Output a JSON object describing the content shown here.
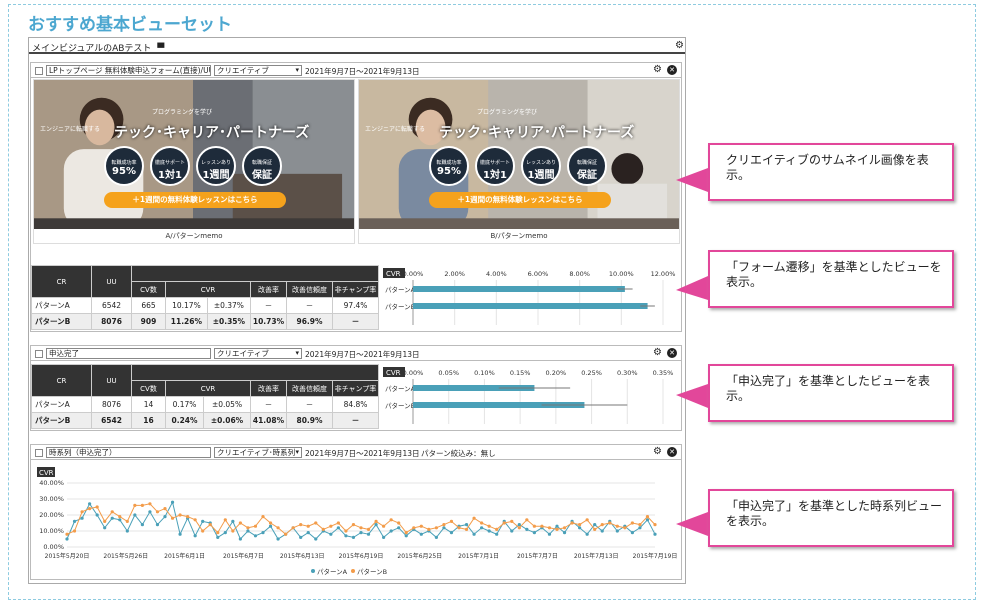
{
  "page_title": "おすすめ基本ビューセット",
  "outer": {
    "title": "メインビジュアルのABテスト"
  },
  "panel1": {
    "field": "LPトップページ 無料体験申込フォーム(直接)/UU",
    "select": "クリエイティブ",
    "date": "2021年9月7日～2021年9月13日",
    "thumb_a": {
      "caption": "A/パターンmemo",
      "sub": "プログラミングを学び",
      "sub2": "エンジニアに転職する",
      "headline": "テック･キャリア･パートナーズ",
      "badges": [
        {
          "main": "95%",
          "small": "転職成功率"
        },
        {
          "main": "1対1",
          "small": "徹底サポート"
        },
        {
          "main": "1週間",
          "small": "レッスンあり"
        },
        {
          "main": "保証",
          "small": "転職保証"
        }
      ],
      "button": "＋1週間の無料体験レッスンはこちら"
    },
    "thumb_b": {
      "caption": "B/パターンmemo",
      "sub": "プログラミングを学び",
      "sub2": "エンジニアに転職する",
      "headline": "テック･キャリア･パートナーズ",
      "badges": [
        {
          "main": "95%",
          "small": "転職成功率"
        },
        {
          "main": "1対1",
          "small": "徹底サポート"
        },
        {
          "main": "1週間",
          "small": "レッスンあり"
        },
        {
          "main": "保証",
          "small": "転職保証"
        }
      ],
      "button": "＋1週間の無料体験レッスンはこちら"
    },
    "table": {
      "headers": [
        "CR",
        "UU",
        "CV数",
        "CVR",
        "改善率",
        "改善信頼度",
        "非チャンプ率"
      ],
      "rows": [
        [
          "パターンA",
          "6542",
          "665",
          "10.17%",
          "±0.37%",
          "－",
          "－",
          "97.4%"
        ],
        [
          "パターンB",
          "8076",
          "909",
          "11.26%",
          "±0.35%",
          "10.73%",
          "96.9%",
          "－"
        ]
      ]
    }
  },
  "panel2": {
    "field": "申込完了",
    "select": "クリエイティブ",
    "date": "2021年9月7日～2021年9月13日",
    "table": {
      "headers": [
        "CR",
        "UU",
        "CV数",
        "CVR",
        "改善率",
        "改善信頼度",
        "非チャンプ率"
      ],
      "rows": [
        [
          "パターンA",
          "8076",
          "14",
          "0.17%",
          "±0.05%",
          "－",
          "－",
          "84.8%"
        ],
        [
          "パターンB",
          "6542",
          "16",
          "0.24%",
          "±0.06%",
          "41.08%",
          "80.9%",
          "－"
        ]
      ]
    }
  },
  "panel3": {
    "field": "時系列（申込完了）",
    "select": "クリエイティブ･時系列",
    "date": "2021年9月7日～2021年9月13日",
    "filter": "パターン絞込み：無し"
  },
  "callouts": [
    "クリエイティブのサムネイル画像を表示。",
    "「フォーム遷移」を基準としたビューを表示。",
    "「申込完了」を基準としたビューを表示。",
    "「申込完了」を基準とした時系列ビューを表示。"
  ],
  "chart_data": [
    {
      "type": "bar",
      "title": "CVR",
      "categories": [
        "パターンA",
        "パターンB"
      ],
      "values": [
        10.17,
        11.26
      ],
      "errors": [
        0.37,
        0.35
      ],
      "xlim": [
        0,
        12
      ],
      "ticks": [
        "0.00%",
        "2.00%",
        "4.00%",
        "6.00%",
        "8.00%",
        "10.00%",
        "12.00%"
      ],
      "color": "#4aa0b8"
    },
    {
      "type": "bar",
      "title": "CVR",
      "categories": [
        "パターンA",
        "パターンB"
      ],
      "values": [
        0.17,
        0.24
      ],
      "errors": [
        0.05,
        0.06
      ],
      "xlim": [
        0,
        0.35
      ],
      "ticks": [
        "0.00%",
        "0.05%",
        "0.10%",
        "0.15%",
        "0.20%",
        "0.25%",
        "0.30%",
        "0.35%"
      ],
      "color": "#4aa0b8"
    },
    {
      "type": "line",
      "title": "CVR",
      "ylim": [
        0,
        40
      ],
      "yticks": [
        "40.00%",
        "30.00%",
        "20.00%",
        "10.00%",
        "0.00%"
      ],
      "xticks": [
        "2015年5月20日",
        "2015年5月26日",
        "2015年6月1日",
        "2015年6月7日",
        "2015年6月13日",
        "2015年6月19日",
        "2015年6月25日",
        "2015年7月1日",
        "2015年7月7日",
        "2015年7月13日",
        "2015年7月19日"
      ],
      "series": [
        {
          "name": "パターンA",
          "color": "#4aa0b8",
          "values": [
            5,
            16,
            18,
            27,
            20,
            12,
            18,
            17,
            10,
            20,
            14,
            22,
            14,
            19,
            28,
            8,
            18,
            7,
            16,
            15,
            6,
            9,
            16,
            5,
            10,
            7,
            9,
            13,
            5,
            8,
            12,
            6,
            9,
            5,
            10,
            8,
            12,
            7,
            6,
            9,
            8,
            14,
            6,
            10,
            12,
            7,
            11,
            8,
            10,
            6,
            12,
            9,
            13,
            14,
            8,
            12,
            10,
            8,
            16,
            10,
            14,
            11,
            9,
            12,
            8,
            13,
            9,
            16,
            12,
            8,
            14,
            10,
            16,
            10,
            13,
            9,
            12,
            17,
            8
          ]
        },
        {
          "name": "パターンB",
          "color": "#f39c4a",
          "values": [
            8,
            10,
            22,
            24,
            25,
            16,
            22,
            19,
            16,
            26,
            26,
            27,
            22,
            24,
            18,
            20,
            19,
            17,
            10,
            14,
            9,
            17,
            10,
            15,
            12,
            13,
            19,
            15,
            12,
            8,
            12,
            14,
            13,
            15,
            11,
            13,
            15,
            10,
            14,
            12,
            11,
            16,
            13,
            17,
            15,
            9,
            12,
            13,
            11,
            12,
            14,
            16,
            12,
            11,
            18,
            15,
            13,
            11,
            15,
            16,
            12,
            17,
            13,
            13,
            12,
            11,
            12,
            15,
            14,
            17,
            11,
            14,
            15,
            13,
            12,
            15,
            14,
            19,
            14
          ]
        }
      ],
      "legend": "bottom"
    }
  ]
}
